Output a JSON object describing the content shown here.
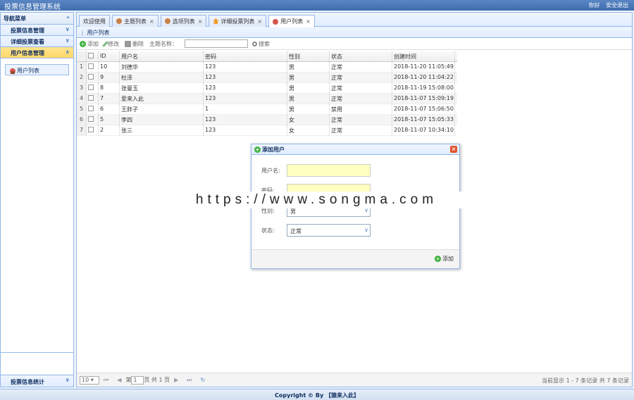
{
  "app": {
    "title": "投票信息管理系统",
    "greeting": "你好",
    "logout": "安全退出"
  },
  "sidebar": {
    "header": "导航菜单",
    "sections": [
      {
        "label": "投票信息管理"
      },
      {
        "label": "详细投票查看"
      },
      {
        "label": "用户信息管理"
      }
    ],
    "items": [
      {
        "label": "用户列表"
      }
    ],
    "bottom": "投票信息统计"
  },
  "tabs": [
    {
      "label": "欢迎使用"
    },
    {
      "label": "主题列表"
    },
    {
      "label": "选项列表"
    },
    {
      "label": "详细投票列表"
    },
    {
      "label": "用户列表"
    }
  ],
  "panel": {
    "title": "用户列表"
  },
  "toolbar": {
    "add": "添加",
    "edit": "修改",
    "delete": "删除",
    "search_label": "主题名称：",
    "search_value": "",
    "search": "搜索"
  },
  "table": {
    "columns": [
      "ID",
      "用户名",
      "密码",
      "性别",
      "状态",
      "创建时间"
    ],
    "rows": [
      {
        "num": "1",
        "id": "10",
        "name": "刘德华",
        "pwd": "123",
        "sex": "男",
        "status": "正常",
        "time": "2018-11-20 11:05:49"
      },
      {
        "num": "2",
        "id": "9",
        "name": "杜泽",
        "pwd": "123",
        "sex": "男",
        "status": "正常",
        "time": "2018-11-20 11:04:22"
      },
      {
        "num": "3",
        "id": "8",
        "name": "张曼玉",
        "pwd": "123",
        "sex": "男",
        "status": "正常",
        "time": "2018-11-19 15:08:00"
      },
      {
        "num": "4",
        "id": "7",
        "name": "爱来入此",
        "pwd": "123",
        "sex": "男",
        "status": "正常",
        "time": "2018-11-07 15:09:19"
      },
      {
        "num": "5",
        "id": "6",
        "name": "王胖子",
        "pwd": "1",
        "sex": "男",
        "status": "禁用",
        "time": "2018-11-07 15:06:50"
      },
      {
        "num": "6",
        "id": "5",
        "name": "李四",
        "pwd": "123",
        "sex": "女",
        "status": "正常",
        "time": "2018-11-07 15:05:33"
      },
      {
        "num": "7",
        "id": "2",
        "name": "张三",
        "pwd": "123",
        "sex": "女",
        "status": "正常",
        "time": "2018-11-07 10:34:10"
      }
    ]
  },
  "pager": {
    "page_size": "10",
    "page_prefix": "第",
    "page": "1",
    "page_suffix": "页 共 1 页",
    "info": "当前显示 1 - 7 条记录 共 7 条记录"
  },
  "dialog": {
    "title": "添加用户",
    "fields": [
      {
        "label": "用户名:",
        "value": ""
      },
      {
        "label": "密码:",
        "value": ""
      },
      {
        "label": "性别:",
        "value": "男"
      },
      {
        "label": "状态:",
        "value": "正常"
      }
    ],
    "submit": "添加"
  },
  "footer": {
    "text": "Copyright © By 【猿来入此】"
  },
  "watermark": "https://www.songma.com"
}
